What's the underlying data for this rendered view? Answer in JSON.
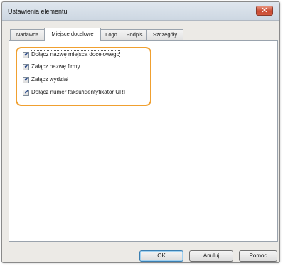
{
  "window": {
    "title": "Ustawienia elementu",
    "close_glyph": "✕"
  },
  "tabs": [
    {
      "label": "Nadawca"
    },
    {
      "label": "Miejsce docelowe",
      "active": true
    },
    {
      "label": "Logo"
    },
    {
      "label": "Podpis"
    },
    {
      "label": "Szczegóły"
    }
  ],
  "options": [
    {
      "label": "Dołącz nazwę miejsca docelowego",
      "checked": true
    },
    {
      "label": "Załącz nazwę firmy",
      "checked": true
    },
    {
      "label": "Załącz wydział",
      "checked": true
    },
    {
      "label": "Dołącz numer faksu/identyfikator URI",
      "checked": true
    }
  ],
  "check_glyph": "✔",
  "buttons": {
    "ok": "OK",
    "cancel": "Anuluj",
    "help": "Pomoc"
  },
  "colors": {
    "highlight": "#f0a030",
    "close": "#c94a32"
  }
}
